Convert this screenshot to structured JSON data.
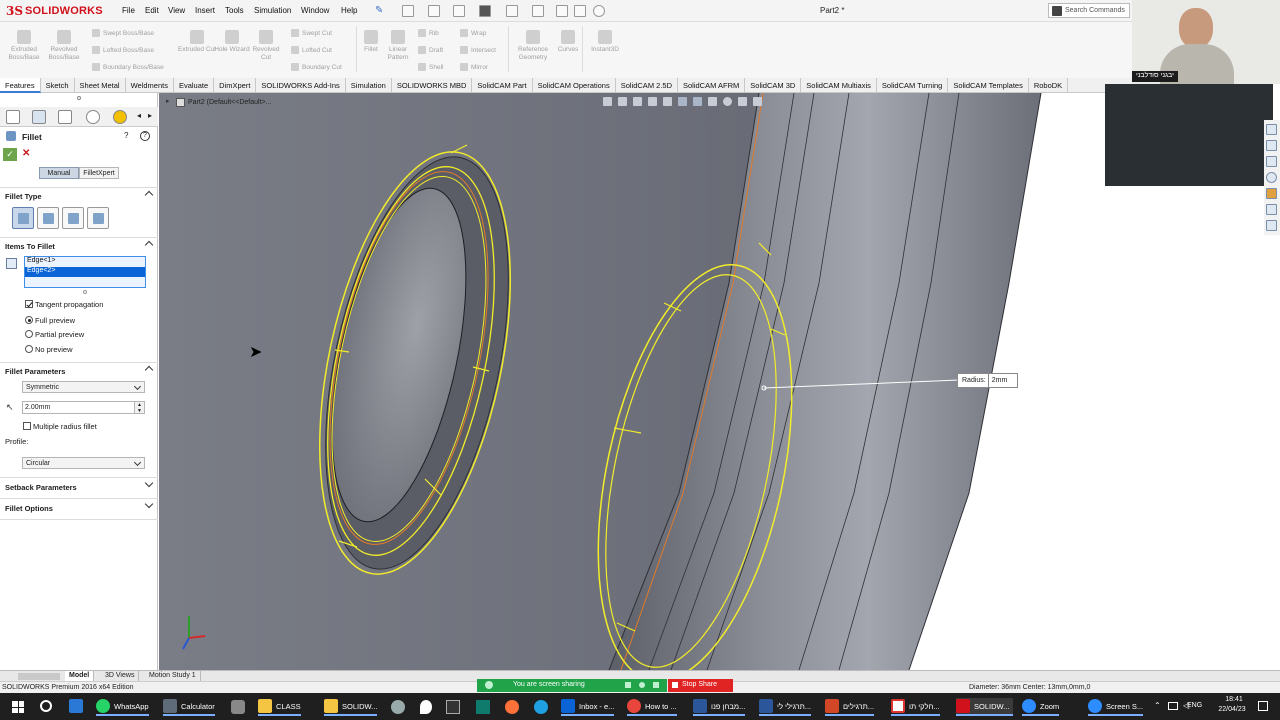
{
  "app": {
    "logo_text": "SOLIDWORKS",
    "document_title": "Part2 *",
    "search_placeholder": "Search Commands"
  },
  "menu": [
    "File",
    "Edit",
    "View",
    "Insert",
    "Tools",
    "Simulation",
    "Window",
    "Help"
  ],
  "commands": {
    "extruded_boss": "Extruded Boss/Base",
    "revolved_boss": "Revolved Boss/Base",
    "swept_boss": "Swept Boss/Base",
    "lofted_boss": "Lofted Boss/Base",
    "boundary_boss": "Boundary Boss/Base",
    "extruded_cut": "Extruded Cut",
    "hole_wizard": "Hole Wizard",
    "revolved_cut": "Revolved Cut",
    "swept_cut": "Swept Cut",
    "lofted_cut": "Lofted Cut",
    "boundary_cut": "Boundary Cut",
    "fillet": "Fillet",
    "linear_pattern": "Linear Pattern",
    "rib": "Rib",
    "draft": "Draft",
    "shell": "Shell",
    "wrap": "Wrap",
    "intersect": "Intersect",
    "mirror": "Mirror",
    "reference_geometry": "Reference Geometry",
    "curves": "Curves",
    "instant3d": "Instant3D"
  },
  "tabs": [
    "Features",
    "Sketch",
    "Sheet Metal",
    "Weldments",
    "Evaluate",
    "DimXpert",
    "SOLIDWORKS Add-Ins",
    "Simulation",
    "SOLIDWORKS MBD",
    "SolidCAM Part",
    "SolidCAM Operations",
    "SolidCAM 2.5D",
    "SolidCAM AFRM",
    "SolidCAM 3D",
    "SolidCAM Multiaxis",
    "SolidCAM Turning",
    "SolidCAM Templates",
    "RoboDK"
  ],
  "active_tab": "Features",
  "tree": {
    "breadcrumb": "Part2  (Default<<Default>..."
  },
  "property_manager": {
    "title": "Fillet",
    "mode_manual": "Manual",
    "mode_filletxpert": "FilletXpert",
    "fillet_type_header": "Fillet Type",
    "items_header": "Items To Fillet",
    "items": [
      "Edge<1>",
      "Edge<2>"
    ],
    "tangent_propagation": "Tangent propagation",
    "tangent_checked": true,
    "full_preview": "Full preview",
    "partial_preview": "Partial preview",
    "no_preview": "No preview",
    "selected_preview": "Full preview",
    "params_header": "Fillet Parameters",
    "symmetric": "Symmetric",
    "radius_value": "2.00mm",
    "multiple_radius": "Multiple radius fillet",
    "profile_label": "Profile:",
    "profile_value": "Circular",
    "setback_header": "Setback Parameters",
    "options_header": "Fillet Options"
  },
  "viewport": {
    "radius_callout_label": "Radius:",
    "radius_callout_value": "2mm"
  },
  "bottom_tabs": [
    "Model",
    "3D Views",
    "Motion Study 1"
  ],
  "status": {
    "edition": "SOLIDWORKS Premium 2016 x64 Edition",
    "sharing": "You are screen sharing",
    "stop_share": "Stop Share",
    "measure": "Diameter: 36mm  Center: 13mm,0mm,0"
  },
  "webcam": {
    "name": "יבגני סודלבני"
  },
  "taskbar": {
    "items": [
      "WhatsApp",
      "Calculator",
      "CLASS",
      "SOLIDW...",
      "Inbox - e...",
      "How to ...",
      "מבחן פנו...",
      "תרגילי לי...",
      "תרגילים...",
      "חלקי תו...",
      "SOLIDW...",
      "Zoom",
      "Screen S..."
    ],
    "lang": "ENG",
    "time": "18:41",
    "date": "22/04/23"
  },
  "colors": {
    "accent_red": "#d1111b",
    "selection_blue": "#0a64d6",
    "preview_yellow": "#f2ec2a",
    "model_gray": "#6d707a",
    "share_green": "#21a34a",
    "stop_red": "#e02424"
  }
}
